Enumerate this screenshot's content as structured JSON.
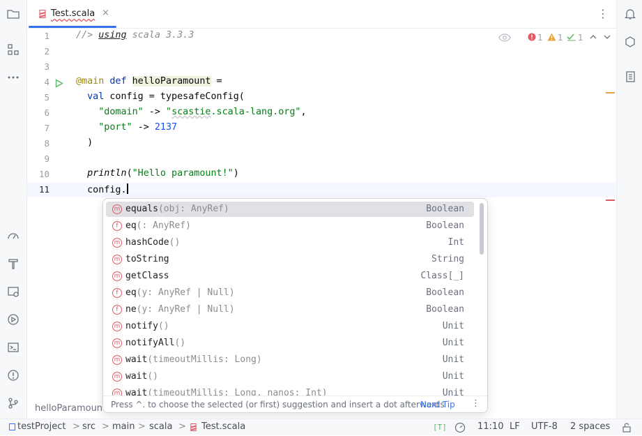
{
  "tab": {
    "filename": "Test.scala",
    "close_glyph": "×",
    "more_glyph": "⋮"
  },
  "inspections": {
    "errors": "1",
    "warnings": "1",
    "ok": "1"
  },
  "editor": {
    "line_numbers": [
      "1",
      "2",
      "3",
      "4",
      "5",
      "6",
      "7",
      "8",
      "9",
      "10",
      "11"
    ],
    "current_line": "11",
    "code": {
      "l1_comment": "//> ",
      "l1_using": "using",
      "l1_rest": " scala 3.3.3",
      "l4_ann": "@main",
      "l4_def": " def ",
      "l4_name": "helloParamount",
      "l4_eq": " =",
      "l5_val": "  val",
      "l5_rest": " config = typesafeConfig(",
      "l6_indent": "    ",
      "l6_key": "\"domain\"",
      "l6_arrow": " -> ",
      "l6_val_a": "\"",
      "l6_val_b": "scastie",
      "l6_val_c": ".scala-lang.org\"",
      "l6_comma": ",",
      "l7_indent": "    ",
      "l7_key": "\"port\"",
      "l7_arrow": " -> ",
      "l7_val": "2137",
      "l8": "  )",
      "l10_indent": "  ",
      "l10_fn": "println",
      "l10_open": "(",
      "l10_str": "\"Hello paramount!\"",
      "l10_close": ")",
      "l11": "  config."
    }
  },
  "completion": {
    "items": [
      {
        "kind": "m",
        "name": "equals",
        "sig": "(obj: AnyRef)",
        "type": "Boolean",
        "selected": true
      },
      {
        "kind": "f",
        "name": "eq",
        "sig": "(: AnyRef)",
        "type": "Boolean"
      },
      {
        "kind": "m",
        "name": "hashCode",
        "sig": "()",
        "type": "Int"
      },
      {
        "kind": "m",
        "name": "toString",
        "sig": "",
        "type": "String"
      },
      {
        "kind": "m",
        "name": "getClass",
        "sig": "",
        "type": "Class[_]"
      },
      {
        "kind": "f",
        "name": "eq",
        "sig": "(y: AnyRef | Null)",
        "type": "Boolean"
      },
      {
        "kind": "f",
        "name": "ne",
        "sig": "(y: AnyRef | Null)",
        "type": "Boolean"
      },
      {
        "kind": "m",
        "name": "notify",
        "sig": "()",
        "type": "Unit"
      },
      {
        "kind": "m",
        "name": "notifyAll",
        "sig": "()",
        "type": "Unit"
      },
      {
        "kind": "m",
        "name": "wait",
        "sig": "(timeoutMillis: Long)",
        "type": "Unit"
      },
      {
        "kind": "m",
        "name": "wait",
        "sig": "()",
        "type": "Unit"
      },
      {
        "kind": "m",
        "name": "wait",
        "sig": "(timeoutMillis: Long, nanos: Int)",
        "type": "Unit"
      }
    ],
    "footer_text": "Press ^. to choose the selected (or first) suggestion and insert a dot afterwards",
    "footer_link": "Next Tip",
    "footer_more": "⋮"
  },
  "breadcrumb_function": "helloParamount()",
  "statusbar": {
    "project": "testProject",
    "path": [
      "src",
      "main",
      "scala"
    ],
    "file": "Test.scala",
    "separator": ">",
    "mode": "[T]",
    "position": "11:10",
    "line_ending": "LF",
    "encoding": "UTF-8",
    "indent": "2 spaces"
  },
  "colors": {
    "accent": "#3574f0",
    "error": "#e55765",
    "warning": "#e9a23b",
    "ok": "#5fb865"
  }
}
